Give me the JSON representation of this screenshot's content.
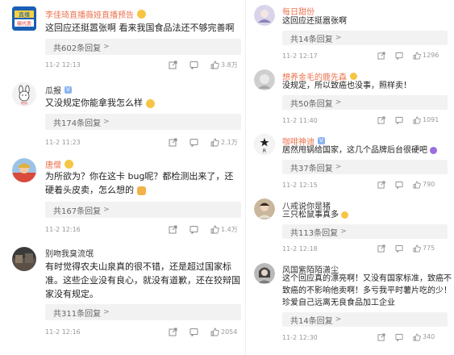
{
  "left": [
    {
      "name": "李佳琦直播薇娅直播预告",
      "badge": "",
      "avatar_text": "直播\n哪代表",
      "text": "这回应还挺嚣张啊 看来我国食品法还不够完善啊",
      "reply": "共602条回复",
      "time": "11-2 12:13",
      "likes": "3.8万"
    },
    {
      "name": "瓜报",
      "badge": "V",
      "avatar_text": "",
      "text": "又没规定你能拿我怎么样",
      "reply": "共174条回复",
      "time": "11-2 11:23",
      "likes": "2.1万"
    },
    {
      "name": "唐僧",
      "badge": "",
      "avatar_text": "",
      "text": "为所欲为？你在这卡 bug呢？都检测出来了，还硬着头皮卖，怎么想的",
      "reply": "共167条回复",
      "time": "11-2 12:16",
      "likes": "1.4万"
    },
    {
      "name": "别吻我臭流氓",
      "badge": "",
      "avatar_text": "",
      "text": "有时觉得农夫山泉真的很不错，还是超过国家标准。这些企业没有良心，就没有道歉，还在狡辩国家没有规定。",
      "reply": "共311条回复",
      "time": "11-2 12:16",
      "likes": "2054"
    }
  ],
  "right": [
    {
      "name": "每日甜份",
      "badge": "",
      "text": "这回应还挺嚣张啊",
      "reply": "共14条回复",
      "time": "11-2 12:17",
      "likes": "1296"
    },
    {
      "name": "想养金毛的鹿先森",
      "badge": "",
      "text": "没规定，所以致癌也没事，照样卖！",
      "reply": "共50条回复",
      "time": "11-2 11:40",
      "likes": "1091"
    },
    {
      "name": "咖啡神迪",
      "badge": "V",
      "text": "居然甩锅给国家，这几个品牌后台很硬吧",
      "reply": "共37条回复",
      "time": "11-2 12:15",
      "likes": "790"
    },
    {
      "name": "八戒说你是猪",
      "badge": "",
      "text": "三只松鼠事真多",
      "reply": "共113条回复",
      "time": "11-2 12:18",
      "likes": "775"
    },
    {
      "name": "风国紫陌陌潇尘",
      "badge": "",
      "text": "这个回应真的漂亮啊！又没有国家标准，致癌不致癌的不影响他卖啊！多亏我平时薯片吃的少！珍爱自己远离无良食品加工企业",
      "reply": "共14条回复",
      "time": "11-2 12:30",
      "likes": "340"
    }
  ],
  "colors": {
    "name": "#eb7350",
    "reply_bg": "#f2f2f2",
    "meta": "#999999"
  }
}
